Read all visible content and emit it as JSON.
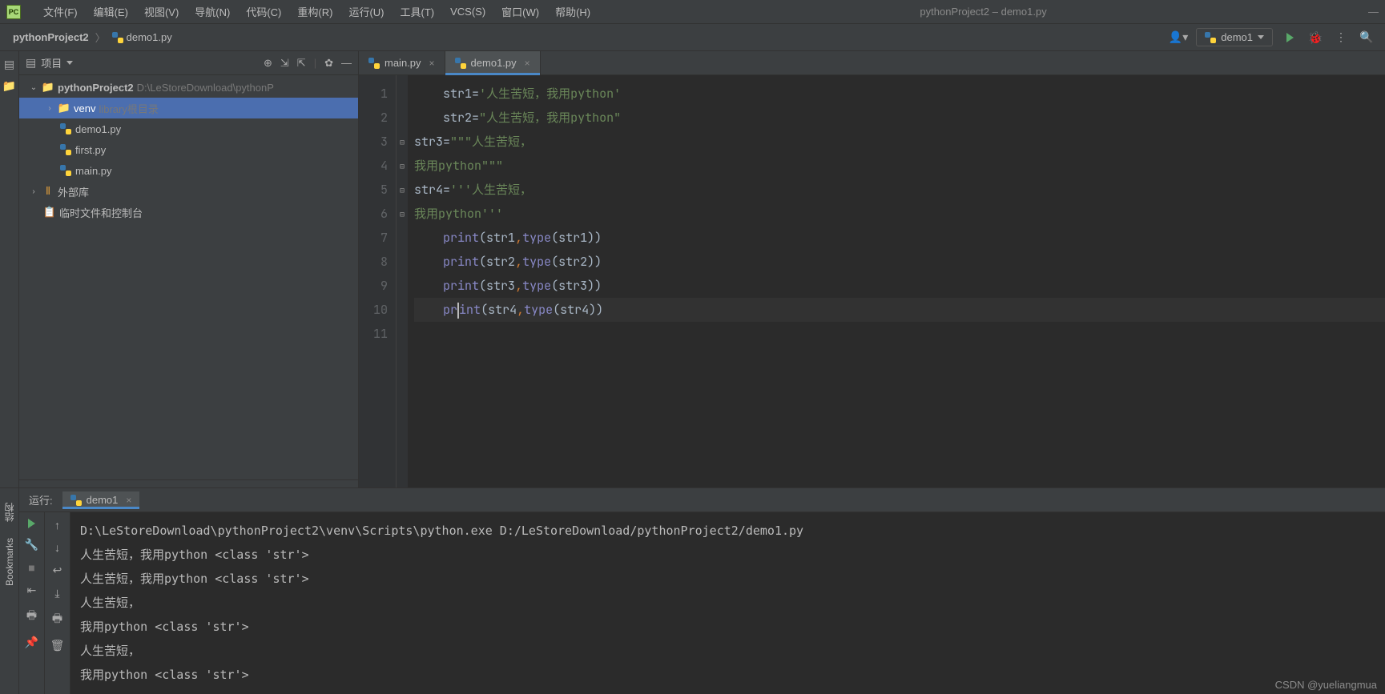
{
  "window": {
    "title": "pythonProject2 – demo1.py"
  },
  "menu": {
    "file": "文件(F)",
    "edit": "编辑(E)",
    "view": "视图(V)",
    "navigate": "导航(N)",
    "code": "代码(C)",
    "refactor": "重构(R)",
    "run": "运行(U)",
    "tools": "工具(T)",
    "vcs": "VCS(S)",
    "window_m": "窗口(W)",
    "help": "帮助(H)"
  },
  "breadcrumb": {
    "project": "pythonProject2",
    "file": "demo1.py"
  },
  "run_config": {
    "name": "demo1"
  },
  "sidebar": {
    "title": "项目",
    "items": [
      {
        "kind": "project",
        "name": "pythonProject2",
        "path": "D:\\LeStoreDownload\\pythonP",
        "arrow": "v",
        "depth": 0
      },
      {
        "kind": "folder",
        "name": "venv",
        "desc": "library根目录",
        "arrow": ">",
        "depth": 1,
        "selected": true
      },
      {
        "kind": "pyfile",
        "name": "demo1.py",
        "depth": 1
      },
      {
        "kind": "pyfile",
        "name": "first.py",
        "depth": 1
      },
      {
        "kind": "pyfile",
        "name": "main.py",
        "depth": 1
      },
      {
        "kind": "lib",
        "name": "外部库",
        "arrow": ">",
        "depth": 0
      },
      {
        "kind": "scratch",
        "name": "临时文件和控制台",
        "depth": 0
      }
    ]
  },
  "left_gutter": {
    "structure": "结构",
    "bookmarks": "Bookmarks"
  },
  "tabs": [
    {
      "name": "main.py",
      "active": false
    },
    {
      "name": "demo1.py",
      "active": true
    }
  ],
  "editor": {
    "lines": [
      {
        "n": 1,
        "segments": [
          {
            "t": "str1",
            "c": "tok-def"
          },
          {
            "t": "=",
            "c": "tok-op"
          },
          {
            "t": "'人生苦短，我用python'",
            "c": "tok-str"
          }
        ],
        "indent": 1
      },
      {
        "n": 2,
        "segments": [
          {
            "t": "str2",
            "c": "tok-def"
          },
          {
            "t": "=",
            "c": "tok-op"
          },
          {
            "t": "\"人生苦短，我用python\"",
            "c": "tok-str"
          }
        ],
        "indent": 1
      },
      {
        "n": 3,
        "segments": [
          {
            "t": "str3",
            "c": "tok-def"
          },
          {
            "t": "=",
            "c": "tok-op"
          },
          {
            "t": "\"\"\"人生苦短，",
            "c": "tok-str"
          }
        ],
        "indent": 0,
        "fold": "⊟"
      },
      {
        "n": 4,
        "segments": [
          {
            "t": "我用python\"\"\"",
            "c": "tok-str"
          }
        ],
        "indent": 0,
        "fold": "⊟"
      },
      {
        "n": 5,
        "segments": [
          {
            "t": "str4",
            "c": "tok-def"
          },
          {
            "t": "=",
            "c": "tok-op"
          },
          {
            "t": "'''人生苦短，",
            "c": "tok-str"
          }
        ],
        "indent": 0,
        "fold": "⊟"
      },
      {
        "n": 6,
        "segments": [
          {
            "t": "我用python'''",
            "c": "tok-str"
          }
        ],
        "indent": 0,
        "fold": "⊟"
      },
      {
        "n": 7,
        "segments": [
          {
            "t": "print",
            "c": "tok-builtin"
          },
          {
            "t": "(str1",
            "c": "tok-paren"
          },
          {
            "t": ",",
            "c": "tok-comma"
          },
          {
            "t": "type",
            "c": "tok-builtin"
          },
          {
            "t": "(str1))",
            "c": "tok-paren"
          }
        ],
        "indent": 1
      },
      {
        "n": 8,
        "segments": [
          {
            "t": "print",
            "c": "tok-builtin"
          },
          {
            "t": "(str2",
            "c": "tok-paren"
          },
          {
            "t": ",",
            "c": "tok-comma"
          },
          {
            "t": "type",
            "c": "tok-builtin"
          },
          {
            "t": "(str2))",
            "c": "tok-paren"
          }
        ],
        "indent": 1
      },
      {
        "n": 9,
        "segments": [
          {
            "t": "print",
            "c": "tok-builtin"
          },
          {
            "t": "(str3",
            "c": "tok-paren"
          },
          {
            "t": ",",
            "c": "tok-comma"
          },
          {
            "t": "type",
            "c": "tok-builtin"
          },
          {
            "t": "(str3))",
            "c": "tok-paren"
          }
        ],
        "indent": 1
      },
      {
        "n": 10,
        "segments": [
          {
            "t": "print",
            "c": "tok-builtin"
          },
          {
            "t": "(str4",
            "c": "tok-paren"
          },
          {
            "t": ",",
            "c": "tok-comma"
          },
          {
            "t": "type",
            "c": "tok-builtin"
          },
          {
            "t": "(str4))",
            "c": "tok-paren"
          }
        ],
        "indent": 1,
        "hl": true,
        "cursor_after": "pr"
      },
      {
        "n": 11,
        "segments": [],
        "indent": 0
      }
    ]
  },
  "run_panel": {
    "label": "运行:",
    "tab": "demo1",
    "output": [
      "D:\\LeStoreDownload\\pythonProject2\\venv\\Scripts\\python.exe D:/LeStoreDownload/pythonProject2/demo1.py",
      "人生苦短，我用python <class 'str'>",
      "人生苦短，我用python <class 'str'>",
      "人生苦短，",
      "我用python <class 'str'>",
      "人生苦短，",
      "我用python <class 'str'>"
    ]
  },
  "watermark": "CSDN @yueliangmua"
}
